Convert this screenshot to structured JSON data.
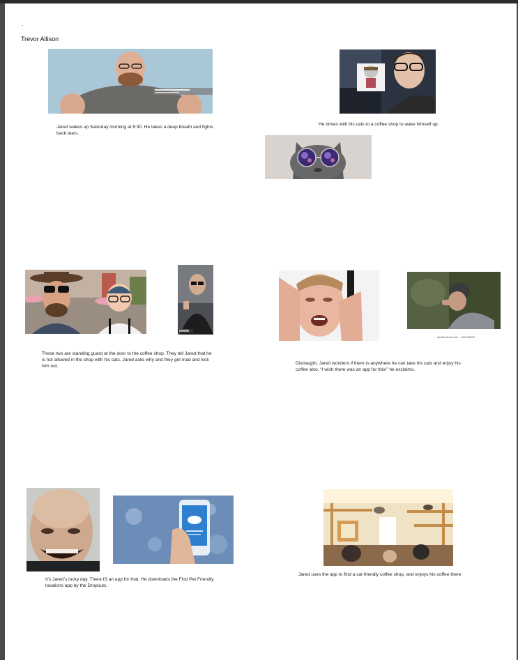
{
  "document": {
    "dot": ".",
    "author": "Trevor Allison"
  },
  "captions": {
    "c1": "Jared wakes up Saturday morning at 6:30. He takes a deep breath and fights back tears.",
    "c2": "He drives with his cats to a coffee shop to wake himself up.",
    "c3": "These two are standing guard at the door to the coffee shop. They tell Jared that he is not allowed in the shop with his cats. Jared asks why and they get mad and kick him out.",
    "c4": "Distraught, Jared wonders if there is anywhere he can take his cats and enjoy his coffee also. “I wish there was an app for this!” he exclaims.",
    "c5": "It’s Jared’s lucky day. There IS an app for that. He downloads the Find Pet Friendly locations app by the Dropouts.",
    "c6": "Jared uses the app to find a cat friendly coffee shop, and enjoys his coffee there"
  },
  "stock": {
    "shutterstock": "shutterstock.com · 151234523"
  },
  "colors": {
    "page_bg": "#ffffff",
    "frame_bg": "#4a4a4a",
    "text": "#222222"
  }
}
